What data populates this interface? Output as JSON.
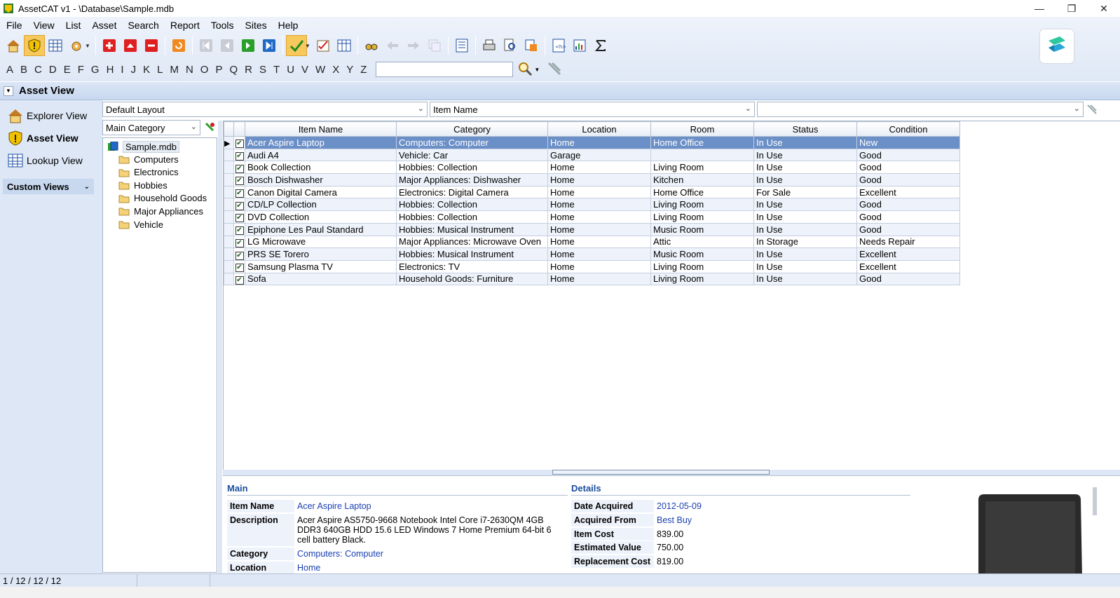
{
  "window": {
    "title": "AssetCAT v1 - \\Database\\Sample.mdb",
    "minimize": "—",
    "restore": "❐",
    "close": "✕"
  },
  "menu": [
    {
      "label": "File"
    },
    {
      "label": "View"
    },
    {
      "label": "List"
    },
    {
      "label": "Asset"
    },
    {
      "label": "Search"
    },
    {
      "label": "Report"
    },
    {
      "label": "Tools"
    },
    {
      "label": "Sites"
    },
    {
      "label": "Help"
    }
  ],
  "alphabet": [
    "A",
    "B",
    "C",
    "D",
    "E",
    "F",
    "G",
    "H",
    "I",
    "J",
    "K",
    "L",
    "M",
    "N",
    "O",
    "P",
    "Q",
    "R",
    "S",
    "T",
    "U",
    "V",
    "W",
    "X",
    "Y",
    "Z"
  ],
  "section": {
    "title": "Asset View"
  },
  "nav": {
    "explorer": "Explorer View",
    "asset": "Asset View",
    "lookup": "Lookup View",
    "custom_views": "Custom Views"
  },
  "layout_combo": "Default Layout",
  "sort_combo": "Item Name",
  "filter_combo": "",
  "tree_combo": "Main Category",
  "tree": {
    "root": "Sample.mdb",
    "children": [
      "Computers",
      "Electronics",
      "Hobbies",
      "Household Goods",
      "Major Appliances",
      "Vehicle"
    ]
  },
  "grid": {
    "columns": [
      "Item Name",
      "Category",
      "Location",
      "Room",
      "Status",
      "Condition"
    ],
    "rows": [
      [
        "Acer Aspire Laptop",
        "Computers: Computer",
        "Home",
        "Home Office",
        "In Use",
        "New"
      ],
      [
        "Audi A4",
        "Vehicle: Car",
        "Garage",
        "",
        "In Use",
        "Good"
      ],
      [
        "Book Collection",
        "Hobbies: Collection",
        "Home",
        "Living Room",
        "In Use",
        "Good"
      ],
      [
        "Bosch Dishwasher",
        "Major Appliances: Dishwasher",
        "Home",
        "Kitchen",
        "In Use",
        "Good"
      ],
      [
        "Canon Digital Camera",
        "Electronics: Digital Camera",
        "Home",
        "Home Office",
        "For Sale",
        "Excellent"
      ],
      [
        "CD/LP Collection",
        "Hobbies: Collection",
        "Home",
        "Living Room",
        "In Use",
        "Good"
      ],
      [
        "DVD Collection",
        "Hobbies: Collection",
        "Home",
        "Living Room",
        "In Use",
        "Good"
      ],
      [
        "Epiphone Les Paul Standard",
        "Hobbies: Musical Instrument",
        "Home",
        "Music Room",
        "In Use",
        "Good"
      ],
      [
        "LG Microwave",
        "Major Appliances: Microwave Oven",
        "Home",
        "Attic",
        "In Storage",
        "Needs Repair"
      ],
      [
        "PRS SE Torero",
        "Hobbies: Musical Instrument",
        "Home",
        "Music Room",
        "In Use",
        "Excellent"
      ],
      [
        "Samsung Plasma TV",
        "Electronics: TV",
        "Home",
        "Living Room",
        "In Use",
        "Excellent"
      ],
      [
        "Sofa",
        "Household Goods: Furniture",
        "Home",
        "Living Room",
        "In Use",
        "Good"
      ]
    ]
  },
  "detail": {
    "main_title": "Main",
    "details_title": "Details",
    "main": [
      {
        "label": "Item Name",
        "value": "Acer Aspire Laptop"
      },
      {
        "label": "Description",
        "value": "Acer Aspire AS5750-9668 Notebook Intel Core i7-2630QM 4GB DDR3 640GB HDD 15.6 LED Windows 7 Home Premium 64-bit 6 cell battery Black."
      },
      {
        "label": "Category",
        "value": "Computers: Computer"
      },
      {
        "label": "Location",
        "value": "Home"
      }
    ],
    "details": [
      {
        "label": "Date Acquired",
        "value": "2012-05-09"
      },
      {
        "label": "Acquired From",
        "value": "Best Buy"
      },
      {
        "label": "Item Cost",
        "value": "839.00"
      },
      {
        "label": "Estimated Value",
        "value": "750.00"
      },
      {
        "label": "Replacement Cost",
        "value": "819.00"
      }
    ]
  },
  "status": {
    "record": "1 / 12 / 12 / 12"
  },
  "colors": {
    "accent": "#6b8fc7",
    "panel": "#dde7f5",
    "link": "#1a3fb0"
  }
}
